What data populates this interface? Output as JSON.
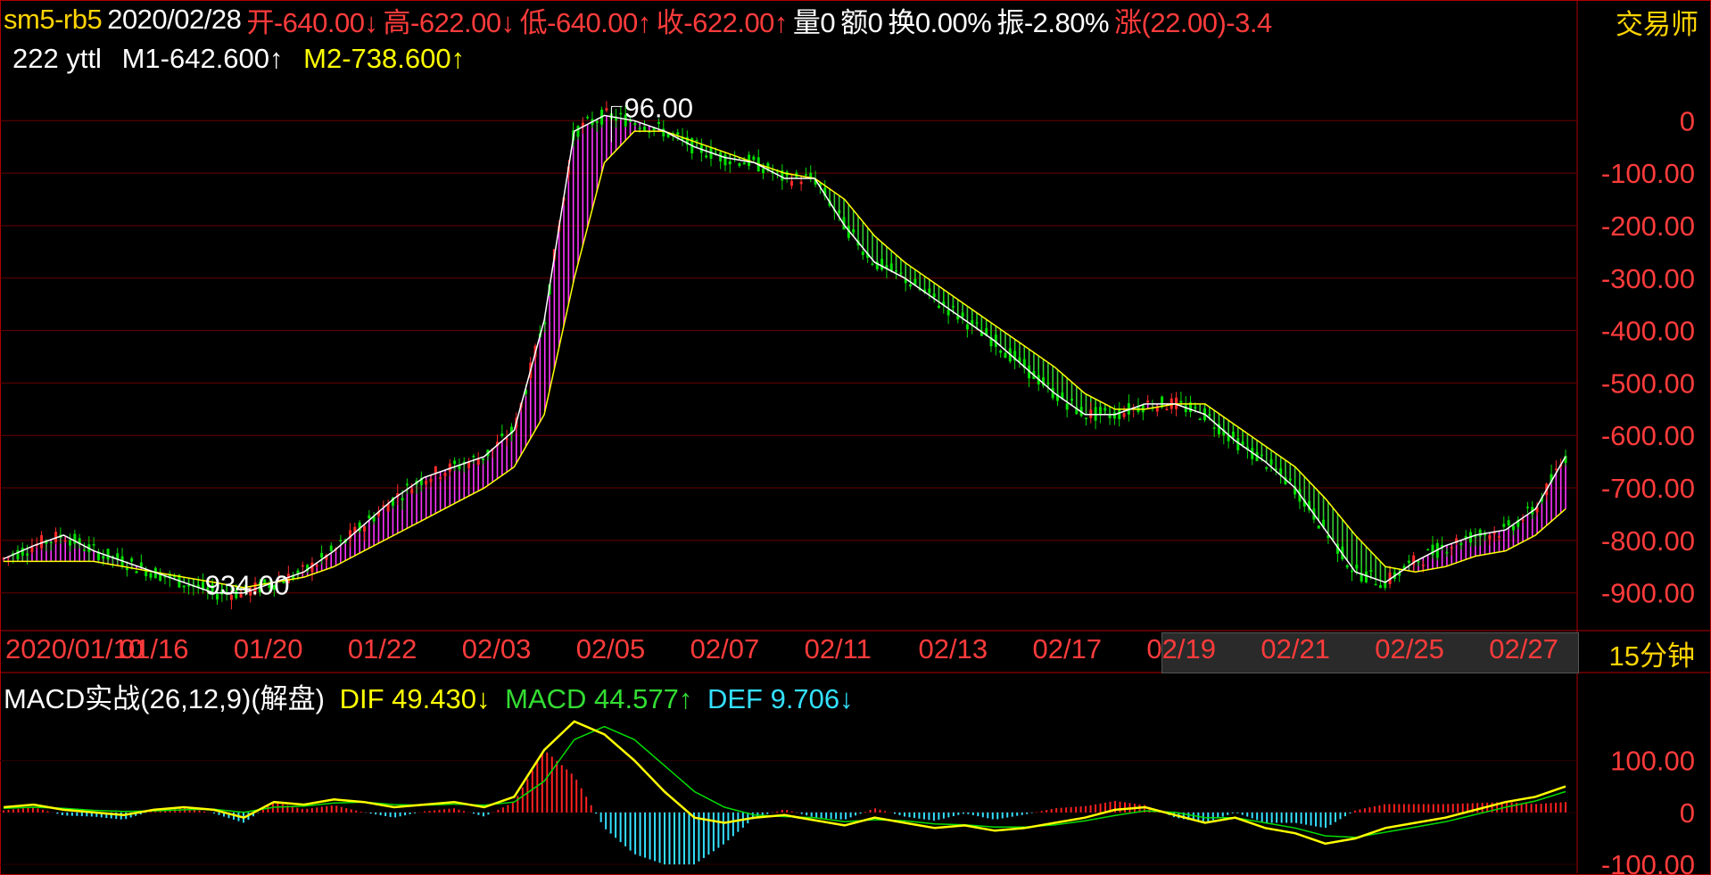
{
  "header": {
    "symbol": "sm5-rb5",
    "date": "2020/02/28",
    "open": "开-640.00↓",
    "high": "高-622.00↓",
    "low": "低-640.00↑",
    "close": "收-622.00↑",
    "volume": "量0",
    "amount": "额0",
    "turnover": "换0.00%",
    "amplitude": "振-2.80%",
    "change": "涨(22.00)-3.4",
    "brand": "交易师"
  },
  "indicator": {
    "name": "222 yttl",
    "m1": "M1-642.600↑",
    "m2": "M2-738.600↑"
  },
  "timeframe": "15分钟",
  "macd_header": {
    "title": "MACD实战(26,12,9)(解盘)",
    "dif": "DIF 49.430↓",
    "macd": "MACD 44.577↑",
    "def": "DEF 9.706↓"
  },
  "colors": {
    "up": "#ff2a2a",
    "down": "#00e000",
    "m1": "#ffffff",
    "m2": "#ffff00",
    "bull_fill": "#ff33ff",
    "bear_fill": "#33cc33",
    "macd_pos": "#ff2020",
    "macd_neg": "#33e0ff",
    "grid": "#6a0000"
  },
  "chart_data": [
    {
      "type": "line",
      "title": "sm5-rb5 15分钟",
      "xlabel": "",
      "ylabel": "",
      "y_ticks": [
        "0",
        "-100.00",
        "-200.00",
        "-300.00",
        "-400.00",
        "-500.00",
        "-600.00",
        "-700.00",
        "-800.00",
        "-900.00"
      ],
      "ylim": [
        -960,
        60
      ],
      "x_ticks": [
        "2020/01/10",
        "01/16",
        "01/20",
        "01/22",
        "02/03",
        "02/05",
        "02/07",
        "02/11",
        "02/13",
        "02/17",
        "02/19",
        "02/21",
        "02/25",
        "02/27"
      ],
      "annotations": [
        "96.00",
        "934.00"
      ],
      "series": [
        {
          "name": "M1",
          "values": [
            -835,
            -810,
            -790,
            -820,
            -840,
            -860,
            -880,
            -900,
            -900,
            -880,
            -860,
            -820,
            -770,
            -720,
            -680,
            -660,
            -640,
            -590,
            -380,
            -20,
            10,
            0,
            -20,
            -50,
            -70,
            -80,
            -110,
            -110,
            -200,
            -270,
            -300,
            -340,
            -380,
            -420,
            -470,
            -520,
            -560,
            -560,
            -540,
            -540,
            -560,
            -610,
            -650,
            -700,
            -780,
            -860,
            -880,
            -840,
            -810,
            -790,
            -780,
            -740,
            -640
          ]
        },
        {
          "name": "M2",
          "values": [
            -840,
            -840,
            -840,
            -840,
            -850,
            -860,
            -870,
            -880,
            -890,
            -880,
            -870,
            -850,
            -820,
            -790,
            -760,
            -730,
            -700,
            -660,
            -560,
            -300,
            -80,
            -20,
            -20,
            -40,
            -60,
            -80,
            -100,
            -110,
            -150,
            -220,
            -270,
            -310,
            -350,
            -390,
            -430,
            -470,
            -520,
            -550,
            -550,
            -540,
            -540,
            -580,
            -620,
            -660,
            -720,
            -790,
            -850,
            -860,
            -850,
            -830,
            -820,
            -790,
            -740
          ]
        }
      ]
    },
    {
      "type": "bar",
      "title": "MACD实战(26,12,9)(解盘)",
      "y_ticks": [
        "100.00",
        "0",
        "-100.00"
      ],
      "ylim": [
        -110,
        190
      ],
      "series": [
        {
          "name": "DIF",
          "values": [
            10,
            15,
            5,
            0,
            -5,
            5,
            10,
            5,
            -10,
            20,
            15,
            25,
            20,
            10,
            15,
            20,
            10,
            30,
            120,
            175,
            150,
            100,
            40,
            -10,
            -20,
            -10,
            -5,
            -15,
            -25,
            -10,
            -20,
            -30,
            -25,
            -35,
            -30,
            -20,
            -10,
            5,
            10,
            -5,
            -20,
            -10,
            -30,
            -40,
            -60,
            -50,
            -30,
            -20,
            -10,
            5,
            20,
            30,
            50
          ]
        },
        {
          "name": "MACD",
          "values": [
            8,
            10,
            8,
            4,
            2,
            3,
            5,
            6,
            0,
            10,
            12,
            18,
            20,
            15,
            14,
            16,
            14,
            20,
            60,
            140,
            165,
            140,
            90,
            40,
            10,
            -5,
            -8,
            -10,
            -18,
            -14,
            -16,
            -22,
            -24,
            -28,
            -28,
            -24,
            -16,
            -6,
            3,
            0,
            -10,
            -10,
            -20,
            -30,
            -45,
            -48,
            -38,
            -28,
            -18,
            -4,
            10,
            22,
            40
          ]
        },
        {
          "name": "DEF",
          "values": [
            4,
            10,
            -6,
            -8,
            -14,
            4,
            10,
            -2,
            -20,
            20,
            6,
            14,
            0,
            -10,
            2,
            8,
            -8,
            20,
            120,
            70,
            -30,
            -80,
            -100,
            -100,
            -60,
            -10,
            6,
            -10,
            -14,
            8,
            -8,
            -16,
            -2,
            -14,
            -4,
            8,
            12,
            22,
            14,
            -10,
            -20,
            0,
            -20,
            -20,
            -30,
            4,
            16,
            16,
            16,
            18,
            20,
            16,
            20
          ]
        }
      ]
    }
  ]
}
